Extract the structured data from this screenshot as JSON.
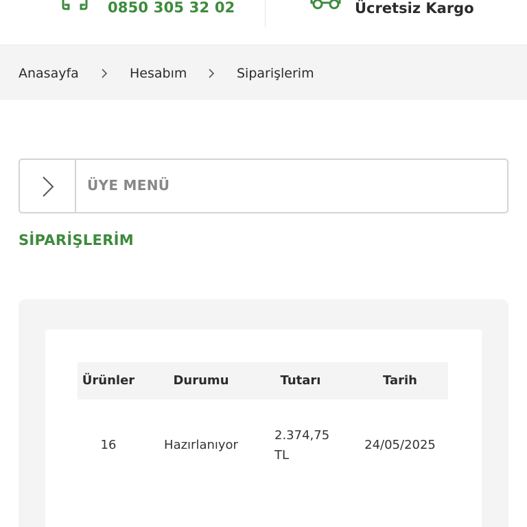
{
  "header": {
    "phone": "0850 305 32 02",
    "shipping": "Ücretsiz Kargo",
    "accent_color": "#3d8a3d",
    "icons": [
      "phone-icon",
      "truck-icon"
    ]
  },
  "breadcrumb": {
    "items": [
      "Anasayfa",
      "Hesabım",
      "Siparişlerim"
    ],
    "separator_icon": "chevron-right-icon"
  },
  "member_menu": {
    "label": "ÜYE MENÜ",
    "icon": "chevron-right-icon"
  },
  "page_title": "SİPARİŞLERİM",
  "orders_table": {
    "columns": [
      "Ürünler",
      "Durumu",
      "Tutarı",
      "Tarih"
    ],
    "rows": [
      {
        "products": "16",
        "status": "Hazırlanıyor",
        "amount": "2.374,75 TL",
        "date": "24/05/2025"
      }
    ]
  }
}
